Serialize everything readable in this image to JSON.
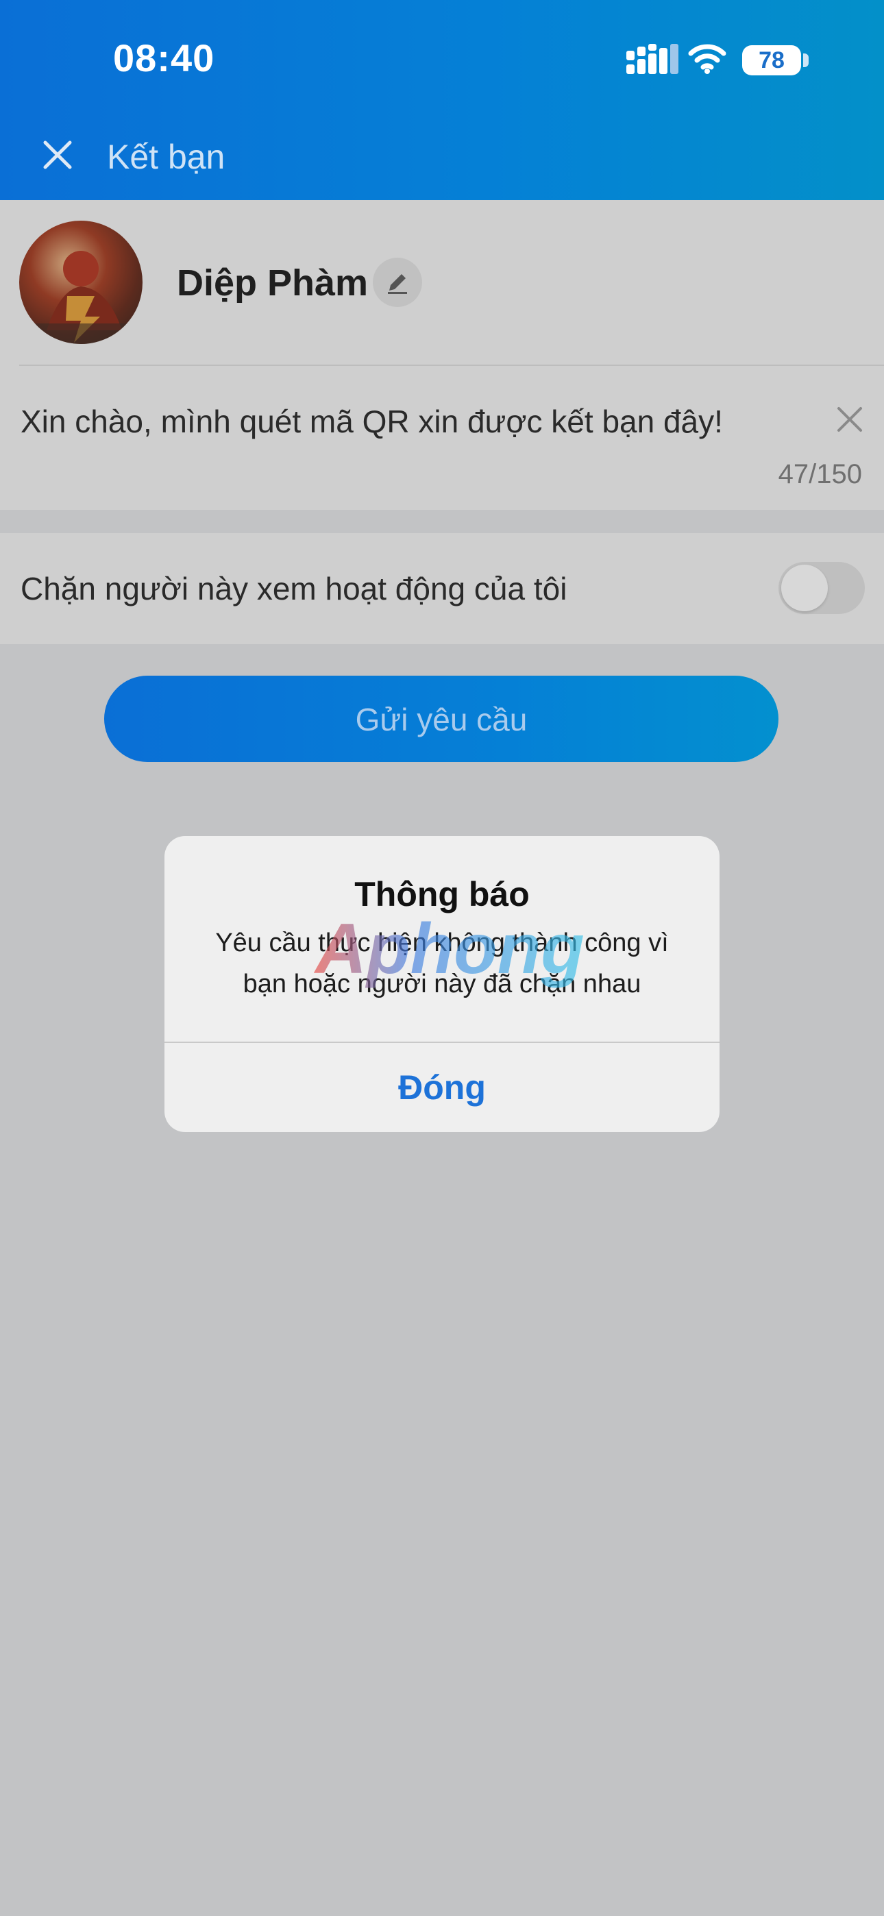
{
  "status_bar": {
    "time": "08:40",
    "battery": "78"
  },
  "header": {
    "title": "Kết bạn"
  },
  "profile": {
    "name": "Diệp Phàm"
  },
  "message": {
    "text": "Xin chào, mình quét mã QR xin được kết bạn đây!",
    "counter": "47/150"
  },
  "settings": {
    "block_label": "Chặn người này xem hoạt động của tôi",
    "block_enabled": false
  },
  "actions": {
    "send_label": "Gửi yêu cầu"
  },
  "dialog": {
    "title": "Thông báo",
    "message": "Yêu cầu thực hiện không thành công vì bạn hoặc người này đã chặn nhau",
    "button": "Đóng"
  },
  "watermark": {
    "text": "Aphong"
  },
  "colors": {
    "brand_blue": "#0a6fd6",
    "dialog_button": "#1d72d8"
  }
}
